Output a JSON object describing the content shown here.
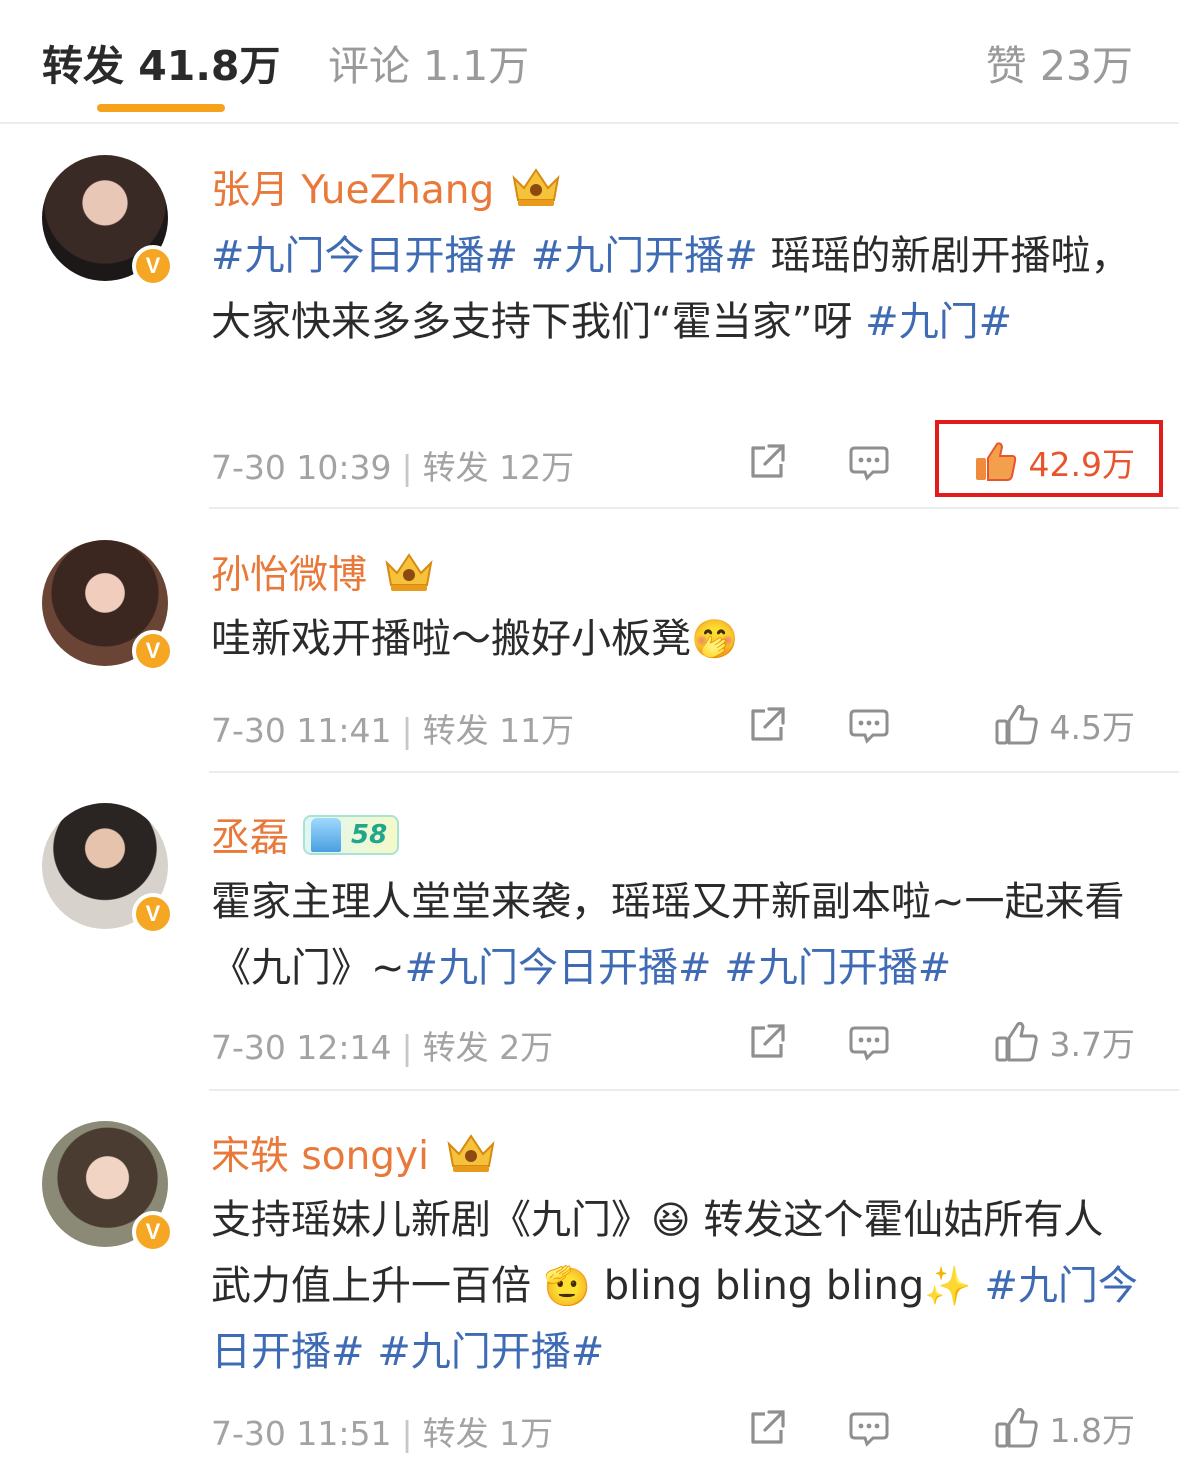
{
  "tabs": {
    "forward": "转发 41.8万",
    "comment": "评论 1.1万",
    "like": "赞 23万"
  },
  "posts": [
    {
      "name": "张月 YueZhang",
      "content": [
        {
          "t": "#九门今日开播#",
          "tag": true
        },
        {
          "t": " ",
          "tag": false
        },
        {
          "t": "#九门开播#",
          "tag": true
        },
        {
          "t": " 瑶瑶的新剧开播啦，大家快来多多支持下我们“霍当家”呀 ",
          "tag": false
        },
        {
          "t": "#九门#",
          "tag": true
        }
      ],
      "time": "7-30 10:39",
      "forward": "转发 12万",
      "likes": "42.9万",
      "liked": true
    },
    {
      "name": "孙怡微博",
      "content": [
        {
          "t": "哇新戏开播啦～搬好小板凳",
          "tag": false
        },
        {
          "t": "🤭",
          "tag": false
        }
      ],
      "time": "7-30 11:41",
      "forward": "转发 11万",
      "likes": "4.5万",
      "liked": false
    },
    {
      "name": "丞磊",
      "badge": "58",
      "content": [
        {
          "t": "霍家主理人堂堂来袭，瑶瑶又开新副本啦~一起来看《九门》~",
          "tag": false
        },
        {
          "t": "#九门今日开播#",
          "tag": true
        },
        {
          "t": " ",
          "tag": false
        },
        {
          "t": "#九门开播#",
          "tag": true
        }
      ],
      "time": "7-30 12:14",
      "forward": "转发 2万",
      "likes": "3.7万",
      "liked": false
    },
    {
      "name": "宋轶 songyi",
      "content": [
        {
          "t": "支持瑶妹儿新剧《九门》",
          "tag": false
        },
        {
          "t": "😆",
          "tag": false
        },
        {
          "t": " 转发这个霍仙姑所有人武力值上升一百倍 ",
          "tag": false
        },
        {
          "t": "🫡",
          "tag": false
        },
        {
          "t": " bling bling bling",
          "tag": false
        },
        {
          "t": "✨",
          "tag": false
        },
        {
          "t": " ",
          "tag": false
        },
        {
          "t": "#九门今日开播#",
          "tag": true
        },
        {
          "t": " ",
          "tag": false
        },
        {
          "t": "#九门开播#",
          "tag": true
        }
      ],
      "time": "7-30 11:51",
      "forward": "转发 1万",
      "likes": "1.8万",
      "liked": false
    }
  ],
  "icons": {
    "share": "share-icon",
    "comment": "comment-icon",
    "like": "thumbs-up-icon",
    "crown": "crown-badge-icon",
    "verified": "verified-v-icon"
  },
  "colors": {
    "username": "#e8793a",
    "hashtag": "#3e6bb3",
    "accent": "#f7a21b",
    "liked": "#e8552c",
    "highlight": "#e21b1b"
  }
}
